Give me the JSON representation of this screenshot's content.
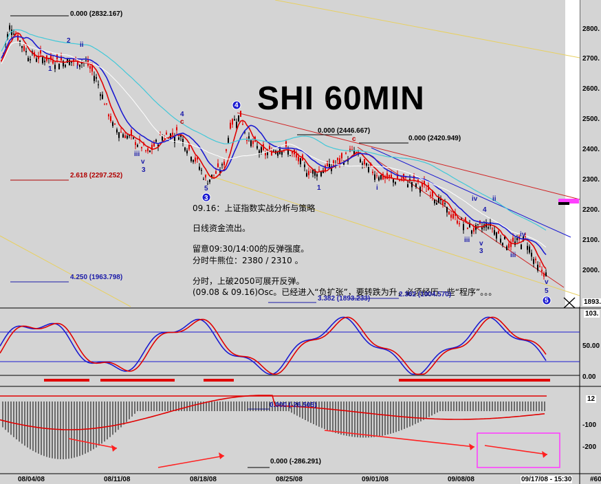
{
  "chart_data": {
    "type": "candlestick",
    "title": "SHI 60MIN",
    "price_axis": {
      "ticks": [
        "2800.",
        "2700.",
        "2600.",
        "2500.",
        "2400.",
        "2300.",
        "2200.",
        "2100.",
        "2000."
      ],
      "last_price": "1893."
    },
    "osc_axis": {
      "ticks": [
        "103.",
        "50.00",
        "0.00"
      ]
    },
    "macd_axis": {
      "ticks": [
        "12",
        "-100",
        "-200"
      ]
    },
    "dates": [
      "08/04/08",
      "08/11/08",
      "08/18/08",
      "08/25/08",
      "09/01/08",
      "09/08/08",
      "09/17/08 - 15:30"
    ],
    "corner_label": "#60",
    "fib_levels": [
      {
        "text": "0.000 (2832.167)",
        "color": "#000000"
      },
      {
        "text": "2.618 (2297.252)",
        "color": "#b00000"
      },
      {
        "text": "4.250 (1963.798)",
        "color": "#1a1aa8"
      },
      {
        "text": "0.000 (2446.667)",
        "color": "#000000"
      },
      {
        "text": "0.000 (2420.949)",
        "color": "#000000"
      },
      {
        "text": "3.382 (1893.233)",
        "color": "#1a1aa8"
      },
      {
        "text": "2.382 (1904.570)",
        "color": "#1a1aa8"
      },
      {
        "text": "0.000 (-26.505)",
        "color": "#1a1aa8"
      },
      {
        "text": "0.000 (-286.291)",
        "color": "#000000"
      }
    ],
    "wave_labels": {
      "w1": "1",
      "w2": "2",
      "wii": "ii",
      "wi": "i",
      "w4": "4",
      "wc": "c",
      "wiii": "iii",
      "wv": "v",
      "w3": "3",
      "w5": "5",
      "wci": "3",
      "w4c": "4",
      "w5c": "5",
      "wc2": "c",
      "w1b": "1",
      "wi2": "i",
      "wiv": "iv",
      "wii2": "ii",
      "w4b": "4",
      "wiii2": "iii",
      "wv2": "v",
      "w3b": "3",
      "wiii3": "iii",
      "wiv2": "iv",
      "wv3": "v",
      "w5b": "5",
      "w5c2": "5"
    },
    "notes": [
      "09.16：上证指数实战分析与策略",
      "日线资金流出。",
      "留意09:30/14:00的反弹强度。",
      "分时牛熊位：2380 / 2310 。",
      "分时，上破2050可展开反弹。",
      "(09.08 & 09.16)Osc。已经进入“负扩张”，要转跌为升，必须经历一些“程序”。。。"
    ],
    "colors": {
      "up": "#000000",
      "down": "#e00000",
      "fast_ma": "#e00000",
      "slow_ma": "#1a1ad0",
      "long_ma": "#40c8d8",
      "channel": "#e8d060",
      "trend": "#d02020"
    }
  }
}
